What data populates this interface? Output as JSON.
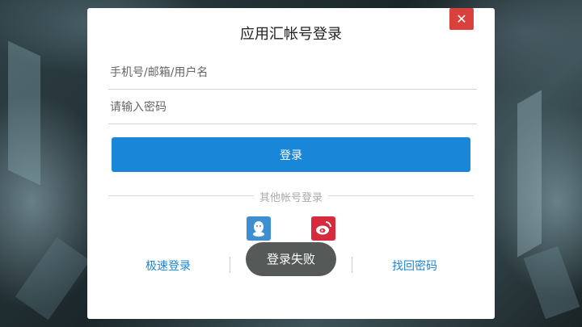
{
  "dialog": {
    "title": "应用汇帐号登录",
    "close_label": "✕",
    "username": {
      "placeholder": "手机号/邮箱/用户名",
      "value": ""
    },
    "password": {
      "placeholder": "请输入密码",
      "value": ""
    },
    "login_label": "登录",
    "other_login_label": "其他帐号登录",
    "social": [
      {
        "icon": "qq-icon",
        "color": "#3e8fd1"
      },
      {
        "icon": "weibo-icon",
        "color": "#d52b3c"
      }
    ],
    "quick_login_label": "极速登录",
    "recover_password_label": "找回密码"
  },
  "toast": {
    "text": "登录失败"
  },
  "colors": {
    "accent": "#1a86d8",
    "close": "#d9413e",
    "toast_bg": "#555a58"
  }
}
